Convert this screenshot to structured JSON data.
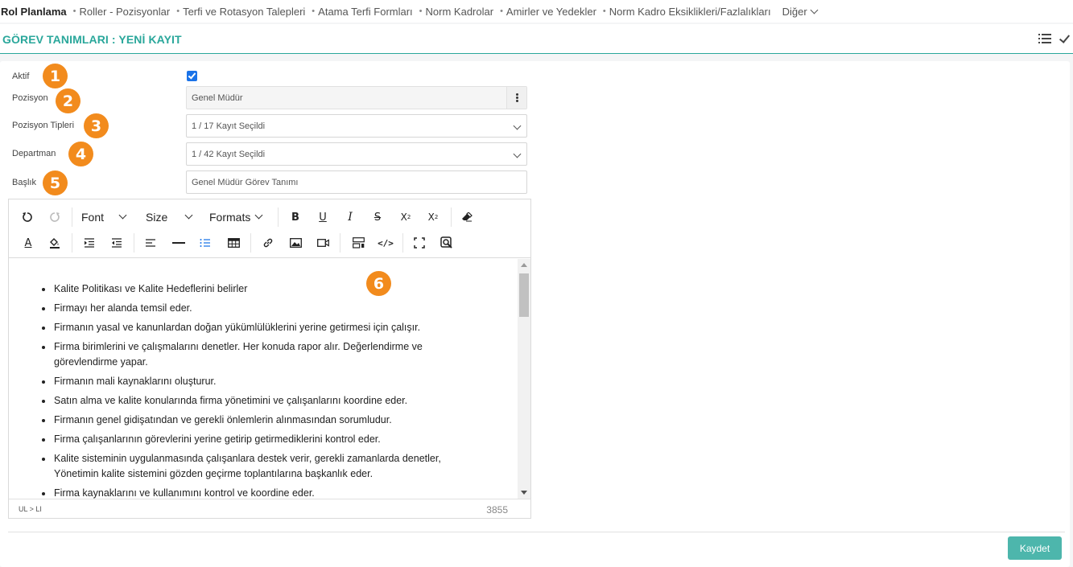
{
  "nav": {
    "items": [
      "Rol Planlama",
      "Roller - Pozisyonlar",
      "Terfi ve Rotasyon Talepleri",
      "Atama Terfi Formları",
      "Norm Kadrolar",
      "Amirler ve Yedekler",
      "Norm Kadro Eksiklikleri/Fazlalıkları",
      "Diğer"
    ]
  },
  "header": {
    "title": "GÖREV TANIMLARI : YENİ KAYIT",
    "icons": [
      "list-icon",
      "check-icon"
    ]
  },
  "form": {
    "aktif": {
      "label": "Aktif",
      "checked": true
    },
    "pozisyon": {
      "label": "Pozisyon",
      "value": "Genel Müdür"
    },
    "pozisyon_tipleri": {
      "label": "Pozisyon Tipleri",
      "value": "1 / 17 Kayıt Seçildi"
    },
    "departman": {
      "label": "Departman",
      "value": "1 / 42 Kayıt Seçildi"
    },
    "baslik": {
      "label": "Başlık",
      "value": "Genel Müdür Görev Tanımı"
    }
  },
  "badges": [
    "1",
    "2",
    "3",
    "4",
    "5",
    "6"
  ],
  "editor": {
    "font_label": "Font",
    "size_label": "Size",
    "formats_label": "Formats",
    "items": [
      "Kalite Politikası ve Kalite Hedeflerini belirler",
      "Firmayı her alanda temsil eder.",
      "Firmanın yasal ve kanunlardan doğan yükümlülüklerini yerine getirmesi için çalışır.",
      "Firma birimlerini ve çalışmalarını denetler. Her konuda rapor alır. Değerlendirme ve görevlendirme yapar.",
      "Firmanın mali kaynaklarını oluşturur.",
      "Satın alma ve kalite konularında firma yönetimini ve çalışanlarını koordine eder.",
      "Firmanın genel gidişatından ve gerekli önlemlerin alınmasından sorumludur.",
      "Firma çalışanlarının görevlerini yerine getirip getirmediklerini kontrol eder.",
      "Kalite sisteminin uygulanmasında çalışanlara destek verir, gerekli zamanlarda denetler, Yönetimin kalite sistemini gözden geçirme toplantılarına başkanlık eder.",
      "Firma kaynaklarını ve kullanımını kontrol ve koordine eder."
    ],
    "status_path": "UL > LI",
    "char_count": "3855"
  },
  "actions": {
    "save_label": "Kaydet"
  },
  "colors": {
    "accent": "#2aa79b",
    "badge": "#f28b1d",
    "button": "#4db6ac",
    "checkbox": "#1a73e8"
  }
}
